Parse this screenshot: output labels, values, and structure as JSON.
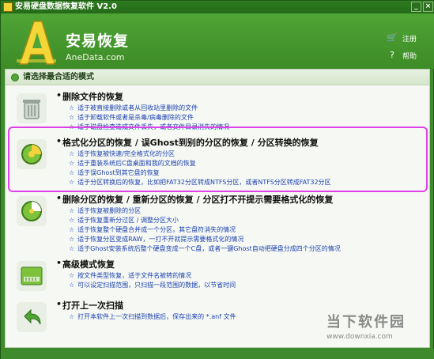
{
  "window": {
    "title": "安易硬盘数据恢复软件 V2.0"
  },
  "brand": {
    "name": "安易恢复",
    "url": "AneData.com"
  },
  "side_menu": [
    {
      "label": "注册",
      "icon": "cart-icon"
    },
    {
      "label": "帮助",
      "icon": "question-icon"
    },
    {
      "label": "关于",
      "icon": "info-icon"
    }
  ],
  "panel": {
    "header": "请选择最合适的模式"
  },
  "options": [
    {
      "title": "删除文件的恢复",
      "icon": "trash-icon",
      "lines": [
        "适于被直接删除或者从回收站里删除的文件",
        "适于卸载软件或者是杀毒/病毒删除的文件",
        "适于磁盘检查造成文件丢失，或者文件目录消失的情况"
      ]
    },
    {
      "title": "格式化分区的恢复 / 误Ghost到别的分区的恢复 / 分区转换的恢复",
      "icon": "format-disk-icon",
      "lines": [
        "适于恢复被快速/完全格式化的分区",
        "适于重装系统后C盘桌面和我的文档的恢复",
        "适于误Ghost到其它盘的恢复",
        "适于分区转换后的恢复，比如把FAT32分区转成NTFS分区，或者NTFS分区转成FAT32分区"
      ]
    },
    {
      "title": "删除分区的恢复 / 重新分区的恢复 / 分区打不开提示需要格式化的恢复",
      "icon": "partition-icon",
      "lines": [
        "适于恢复被删除的分区",
        "适于恢复重新分过区 / 调整分区大小",
        "适于恢复整个硬盘合并成一个分区，其它盘符消失的情况",
        "适于恢复分区变成RAW，一打不开就提示需要格式化的情况",
        "适于Ghost安装系统后整个硬盘变成一个C盘，或者一键Ghost自动把硬盘分成四个分区的情况"
      ]
    },
    {
      "title": "高级模式恢复",
      "icon": "advanced-disk-icon",
      "lines": [
        "按文件类型恢复，适于文件名被转的情况",
        "可以设定扫描范围，只扫描一段范围的数据，以节省时间"
      ]
    },
    {
      "title": "打开上一次扫描",
      "icon": "open-scan-icon",
      "lines": [
        "打开本软件上一次扫描到数据后，保存出来的 *.anf 文件"
      ]
    }
  ],
  "watermark": {
    "text": "当下软件园",
    "url": "www.downxia.com"
  },
  "colors": {
    "frame": "#3f8a2c",
    "highlight": "#e040e8",
    "link": "#1b3fb0"
  }
}
